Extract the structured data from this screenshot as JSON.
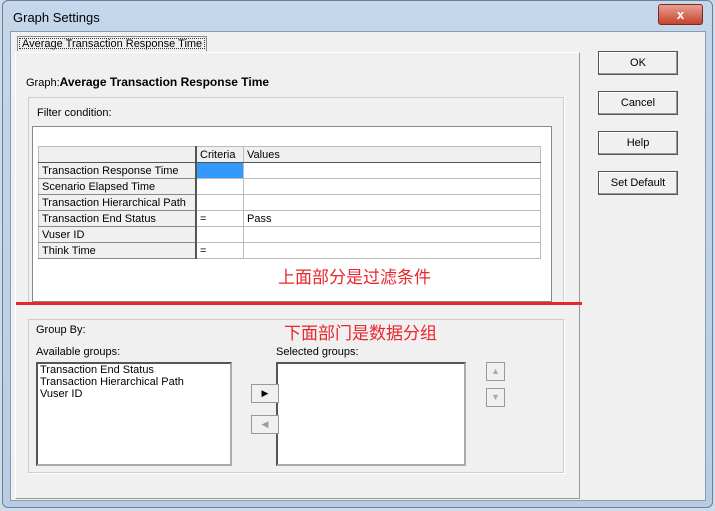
{
  "window": {
    "title": "Graph Settings",
    "close": "x"
  },
  "tab": "Average Transaction Response Time",
  "graph": {
    "label": "Graph:",
    "value": "Average Transaction Response Time"
  },
  "filter": {
    "label": "Filter condition:",
    "headers": [
      "",
      "Criteria",
      "Values"
    ],
    "rows": [
      [
        "Transaction Response Time",
        "",
        ""
      ],
      [
        "Scenario Elapsed Time",
        "",
        ""
      ],
      [
        "Transaction Hierarchical Path",
        "",
        ""
      ],
      [
        "Transaction End Status",
        "=",
        "Pass"
      ],
      [
        "Vuser ID",
        "",
        ""
      ],
      [
        "Think Time",
        "=",
        ""
      ]
    ]
  },
  "annotation_top": "上面部分是过滤条件",
  "annotation_bottom": "下面部门是数据分组",
  "groupby": {
    "label": "Group By:",
    "available_label": "Available groups:",
    "selected_label": "Selected groups:",
    "available": [
      "Transaction End Status",
      "Transaction Hierarchical Path",
      "Vuser ID"
    ],
    "add": "▶",
    "remove": "◀",
    "up": "▲",
    "down": "▼"
  },
  "buttons": {
    "ok": "OK",
    "cancel": "Cancel",
    "help": "Help",
    "set_default": "Set Default"
  },
  "colors": {
    "annotation": "#e8262d",
    "selected_cell": "#3399ff"
  }
}
